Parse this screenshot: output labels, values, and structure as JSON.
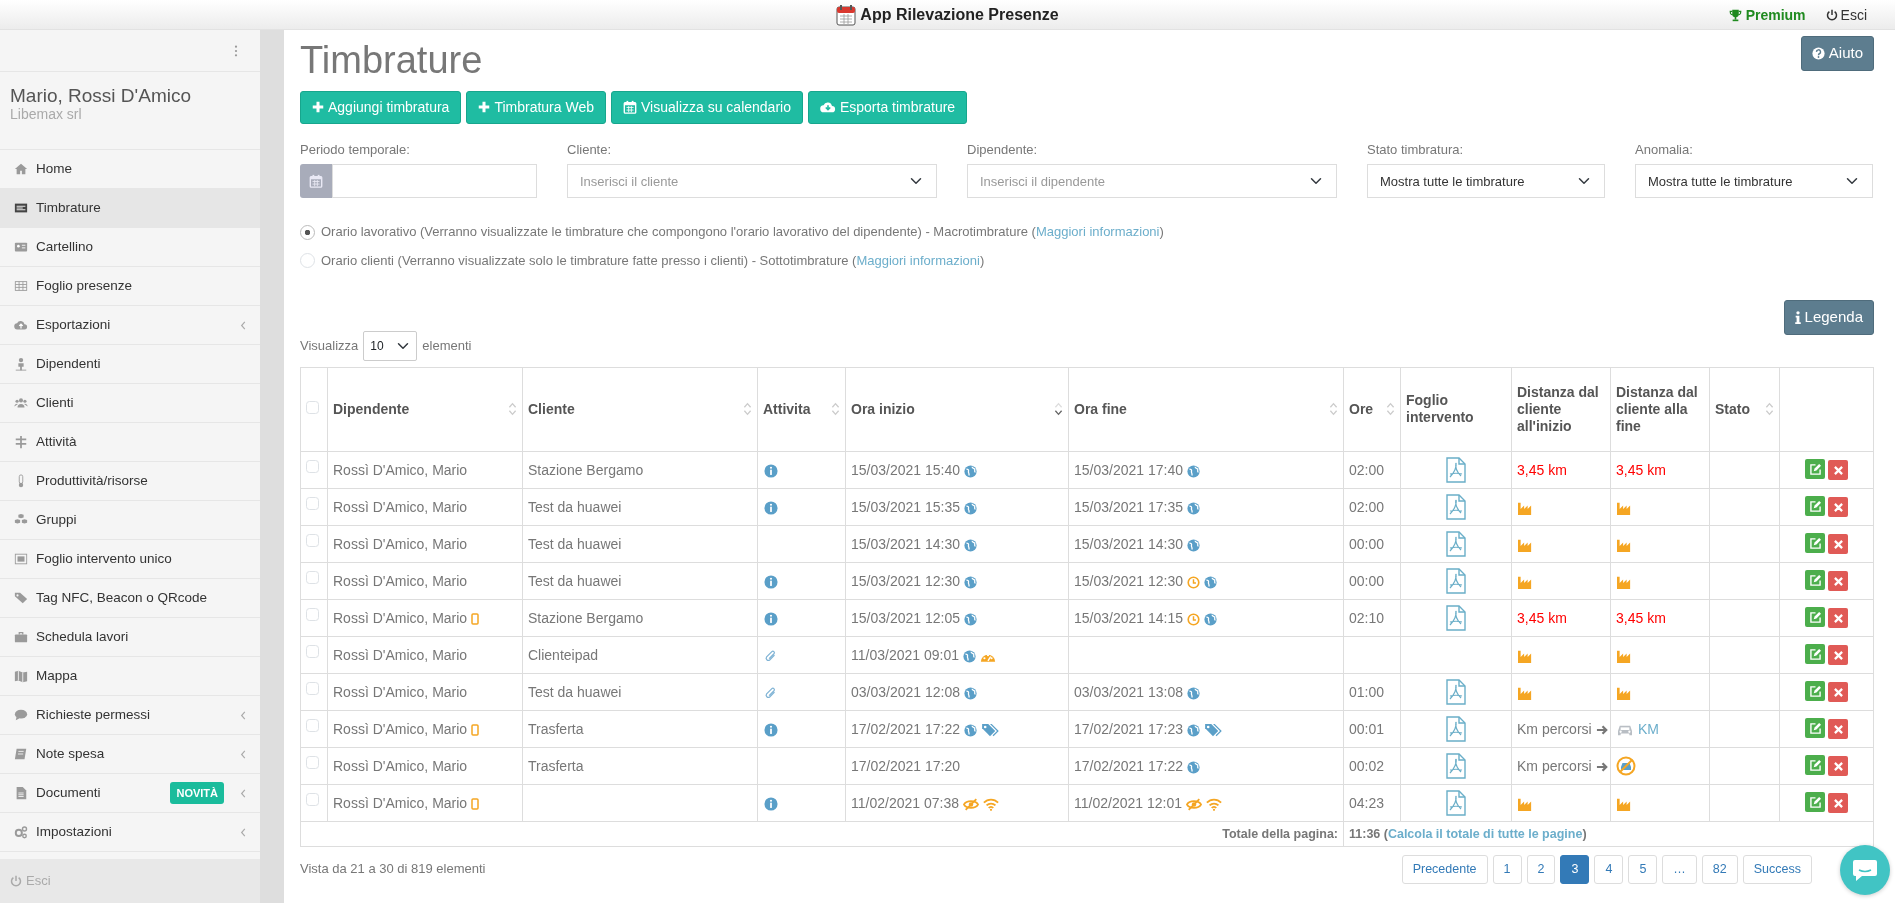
{
  "app_bar": {
    "title": "App Rilevazione Presenze",
    "premium": "Premium",
    "logout": "Esci"
  },
  "sidebar": {
    "user": "Mario, Rossi D'Amico",
    "company": "Libemax srl",
    "items": [
      {
        "label": "Home",
        "selected": false,
        "expandable": false
      },
      {
        "label": "Timbrature",
        "selected": true,
        "expandable": false
      },
      {
        "label": "Cartellino",
        "selected": false,
        "expandable": false
      },
      {
        "label": "Foglio presenze",
        "selected": false,
        "expandable": false
      },
      {
        "label": "Esportazioni",
        "selected": false,
        "expandable": true
      },
      {
        "label": "Dipendenti",
        "selected": false,
        "expandable": false
      },
      {
        "label": "Clienti",
        "selected": false,
        "expandable": false
      },
      {
        "label": "Attività",
        "selected": false,
        "expandable": false
      },
      {
        "label": "Produttività/risorse",
        "selected": false,
        "expandable": false
      },
      {
        "label": "Gruppi",
        "selected": false,
        "expandable": false
      },
      {
        "label": "Foglio intervento unico",
        "selected": false,
        "expandable": false
      },
      {
        "label": "Tag NFC, Beacon o QRcode",
        "selected": false,
        "expandable": false
      },
      {
        "label": "Schedula lavori",
        "selected": false,
        "expandable": false
      },
      {
        "label": "Mappa",
        "selected": false,
        "expandable": false
      },
      {
        "label": "Richieste permessi",
        "selected": false,
        "expandable": true
      },
      {
        "label": "Note spesa",
        "selected": false,
        "expandable": true
      },
      {
        "label": "Documenti",
        "selected": false,
        "expandable": true,
        "badge": "NOVITÀ"
      },
      {
        "label": "Impostazioni",
        "selected": false,
        "expandable": true
      }
    ],
    "logout": "Esci"
  },
  "page": {
    "title": "Timbrature",
    "help_button": "Aiuto",
    "actions": [
      {
        "kind": "add",
        "label": "Aggiungi timbratura"
      },
      {
        "kind": "add",
        "label": "Timbratura Web"
      },
      {
        "kind": "calendar",
        "label": "Visualizza su calendario"
      },
      {
        "kind": "export",
        "label": "Esporta timbrature"
      }
    ],
    "filters": [
      {
        "kind": "date",
        "label": "Periodo temporale:"
      },
      {
        "kind": "search",
        "label": "Cliente:",
        "placeholder": "Inserisci il cliente"
      },
      {
        "kind": "search",
        "label": "Dipendente:",
        "placeholder": "Inserisci il dipendente"
      },
      {
        "kind": "select",
        "label": "Stato timbratura:",
        "value": "Mostra tutte le timbrature"
      },
      {
        "kind": "select",
        "label": "Anomalia:",
        "value": "Mostra tutte le timbrature"
      }
    ],
    "modes": [
      {
        "text": "Orario lavorativo (Verranno visualizzate le timbrature che compongono l'orario lavorativo del dipendente) - Macrotimbrature (",
        "link": "Maggiori informazioni",
        "after": ")",
        "selected": true
      },
      {
        "text": "Orario clienti (Verranno visualizzate solo le timbrature fatte presso i clienti) - Sottotimbrature (",
        "link": "Maggiori informazioni",
        "after": ")",
        "selected": false
      }
    ],
    "legend_button": "Legenda",
    "length": {
      "before": "Visualizza",
      "value": "10",
      "after": "elementi"
    }
  },
  "table": {
    "select_all": {
      "checked": false
    },
    "columns": [
      {
        "label": "Dipendente",
        "sortable": true,
        "sorted_desc": false
      },
      {
        "label": "Cliente",
        "sortable": true,
        "sorted_desc": false
      },
      {
        "label": "Attivita",
        "sortable": true,
        "sorted_desc": false
      },
      {
        "label": "Ora inizio",
        "sortable": true,
        "sorted_desc": true
      },
      {
        "label": "Ora fine",
        "sortable": true,
        "sorted_desc": false
      },
      {
        "label": "Ore",
        "sortable": true,
        "sorted_desc": false
      },
      {
        "label": "Foglio intervento"
      },
      {
        "label": "Distanza dal cliente all'inizio"
      },
      {
        "label": "Distanza dal cliente alla fine"
      },
      {
        "label": "Stato",
        "sortable": true,
        "sorted_desc": false
      }
    ],
    "rows": [
      {
        "checked": false,
        "employee": "Rossì D'Amico, Mario",
        "mobile": false,
        "client": "Stazione Bergamo",
        "activity": {
          "kind": "info"
        },
        "start": {
          "text": "15/03/2021 15:40",
          "icons": [
            {
              "kind": "globe"
            }
          ]
        },
        "end": {
          "text": "15/03/2021 17:40",
          "icons": [
            {
              "kind": "globe"
            }
          ]
        },
        "hours": "02:00",
        "report": true,
        "dist_start": {
          "kind": "km",
          "text": "3,45 km"
        },
        "dist_end": {
          "kind": "km",
          "text": "3,45 km"
        }
      },
      {
        "checked": false,
        "employee": "Rossì D'Amico, Mario",
        "mobile": false,
        "client": "Test da huawei",
        "activity": {
          "kind": "info"
        },
        "start": {
          "text": "15/03/2021 15:35",
          "icons": [
            {
              "kind": "globe"
            }
          ]
        },
        "end": {
          "text": "15/03/2021 17:35",
          "icons": [
            {
              "kind": "globe"
            }
          ]
        },
        "hours": "02:00",
        "report": true,
        "dist_start": {
          "kind": "factory"
        },
        "dist_end": {
          "kind": "factory"
        }
      },
      {
        "checked": false,
        "employee": "Rossì D'Amico, Mario",
        "mobile": false,
        "client": "Test da huawei",
        "start": {
          "text": "15/03/2021 14:30",
          "icons": [
            {
              "kind": "globe"
            }
          ]
        },
        "end": {
          "text": "15/03/2021 14:30",
          "icons": [
            {
              "kind": "globe"
            }
          ]
        },
        "hours": "00:00",
        "report": true,
        "dist_start": {
          "kind": "factory"
        },
        "dist_end": {
          "kind": "factory"
        }
      },
      {
        "checked": false,
        "employee": "Rossì D'Amico, Mario",
        "mobile": false,
        "client": "Test da huawei",
        "activity": {
          "kind": "info"
        },
        "start": {
          "text": "15/03/2021 12:30",
          "icons": [
            {
              "kind": "globe"
            }
          ]
        },
        "end": {
          "text": "15/03/2021 12:30",
          "icons": [
            {
              "kind": "clock"
            },
            {
              "kind": "globe"
            }
          ]
        },
        "hours": "00:00",
        "report": true,
        "dist_start": {
          "kind": "factory"
        },
        "dist_end": {
          "kind": "factory"
        }
      },
      {
        "checked": false,
        "employee": "Rossì D'Amico, Mario",
        "mobile": true,
        "client": "Stazione Bergamo",
        "activity": {
          "kind": "info"
        },
        "start": {
          "text": "15/03/2021 12:05",
          "icons": [
            {
              "kind": "globe"
            }
          ]
        },
        "end": {
          "text": "15/03/2021 14:15",
          "icons": [
            {
              "kind": "clock"
            },
            {
              "kind": "globe"
            }
          ]
        },
        "hours": "02:10",
        "report": true,
        "dist_start": {
          "kind": "km",
          "text": "3,45 km"
        },
        "dist_end": {
          "kind": "km",
          "text": "3,45 km"
        }
      },
      {
        "checked": false,
        "employee": "Rossì D'Amico, Mario",
        "mobile": false,
        "client": "Clienteipad",
        "activity": {
          "kind": "clip"
        },
        "start": {
          "text": "11/03/2021 09:01",
          "icons": [
            {
              "kind": "globe"
            },
            {
              "kind": "gauge"
            }
          ]
        },
        "report": false,
        "dist_start": {
          "kind": "factory"
        },
        "dist_end": {
          "kind": "factory"
        }
      },
      {
        "checked": false,
        "employee": "Rossì D'Amico, Mario",
        "mobile": false,
        "client": "Test da huawei",
        "activity": {
          "kind": "clip"
        },
        "start": {
          "text": "03/03/2021 12:08",
          "icons": [
            {
              "kind": "globe"
            }
          ]
        },
        "end": {
          "text": "03/03/2021 13:08",
          "icons": [
            {
              "kind": "globe"
            }
          ]
        },
        "hours": "01:00",
        "report": true,
        "dist_start": {
          "kind": "factory"
        },
        "dist_end": {
          "kind": "factory"
        }
      },
      {
        "checked": false,
        "employee": "Rossì D'Amico, Mario",
        "mobile": true,
        "client": "Trasferta",
        "activity": {
          "kind": "info"
        },
        "start": {
          "text": "17/02/2021 17:22",
          "icons": [
            {
              "kind": "globe"
            },
            {
              "kind": "tag"
            }
          ]
        },
        "end": {
          "text": "17/02/2021 17:23",
          "icons": [
            {
              "kind": "globe"
            },
            {
              "kind": "tag"
            }
          ]
        },
        "hours": "00:01",
        "report": true,
        "dist_start": {
          "kind": "route",
          "text": "Km percorsi"
        },
        "dist_end": {
          "kind": "car",
          "text": "KM"
        }
      },
      {
        "checked": false,
        "employee": "Rossì D'Amico, Mario",
        "mobile": false,
        "client": "Trasferta",
        "start": {
          "text": "17/02/2021 17:20"
        },
        "end": {
          "text": "17/02/2021 17:22",
          "icons": [
            {
              "kind": "globe"
            }
          ]
        },
        "hours": "00:02",
        "report": true,
        "dist_start": {
          "kind": "route",
          "text": "Km percorsi"
        },
        "dist_end": {
          "kind": "no_car"
        }
      },
      {
        "checked": false,
        "employee": "Rossì D'Amico, Mario",
        "mobile": true,
        "activity": {
          "kind": "info"
        },
        "start": {
          "text": "11/02/2021 07:38",
          "icons": [
            {
              "kind": "hidden"
            },
            {
              "kind": "wifi"
            }
          ]
        },
        "end": {
          "text": "11/02/2021 12:01",
          "icons": [
            {
              "kind": "hidden"
            },
            {
              "kind": "wifi"
            }
          ]
        },
        "hours": "04:23",
        "report": true,
        "dist_start": {
          "kind": "factory"
        },
        "dist_end": {
          "kind": "factory"
        }
      }
    ],
    "total": {
      "label": "Totale della pagina:",
      "value": "11:36 (",
      "link": "Calcola il totale di tutte le pagine",
      "after": ")"
    }
  },
  "footer": {
    "info": "Vista da 21 a 30 di 819 elementi",
    "pages": [
      {
        "label": "Precedente",
        "selected": false
      },
      {
        "label": "1",
        "selected": false
      },
      {
        "label": "2",
        "selected": false
      },
      {
        "label": "3",
        "selected": true
      },
      {
        "label": "4",
        "selected": false
      },
      {
        "label": "5",
        "selected": false
      },
      {
        "label": "…",
        "selected": false
      },
      {
        "label": "82",
        "selected": false
      },
      {
        "label": "Success",
        "selected": false
      }
    ]
  }
}
